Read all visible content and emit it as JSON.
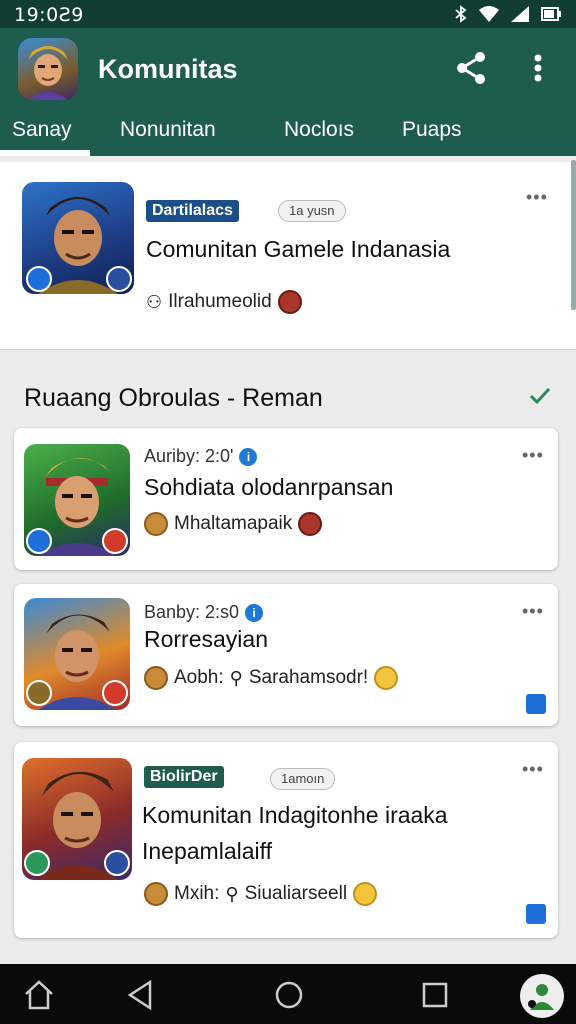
{
  "status": {
    "time": "19:0Ƨ9",
    "icons": [
      "bluetooth-icon",
      "wifi-icon",
      "signal-icon",
      "battery-icon"
    ]
  },
  "app": {
    "title": "Komunitas"
  },
  "tabs": [
    {
      "label": "Sanay"
    },
    {
      "label": "Nonunitan"
    },
    {
      "label": "Nocloıs"
    },
    {
      "label": "Puaps"
    }
  ],
  "top_card": {
    "tag": "Dartilalacs",
    "time": "1a yusn",
    "title": "Comunitan Gamele Indanasia",
    "meta": "Ilrahumeolid"
  },
  "section": {
    "title": "Ruaang Obroulas - Reman"
  },
  "posts": [
    {
      "author": "Auriby: 2:0'",
      "title": "Sohdiata olodanrpansan",
      "meta": "Mhaltamapaik"
    },
    {
      "author": "Banby: 2:s0",
      "title": "Rorresayian",
      "meta_a": "Aobh:",
      "meta_b": "Sarahamsodr!"
    },
    {
      "tag": "BiolirDer",
      "time": "1amoın",
      "title_line1": "Komunitan Indagitonhe iraaka",
      "title_line2": "Inepamlalaiff",
      "meta_a": "Mxih:",
      "meta_b": "Siualiarseell"
    }
  ],
  "colors": {
    "appbar": "#1e5c4e",
    "statusbar": "#113d33",
    "tag": "#1b4f8a",
    "tag2": "#1e5c4e"
  }
}
